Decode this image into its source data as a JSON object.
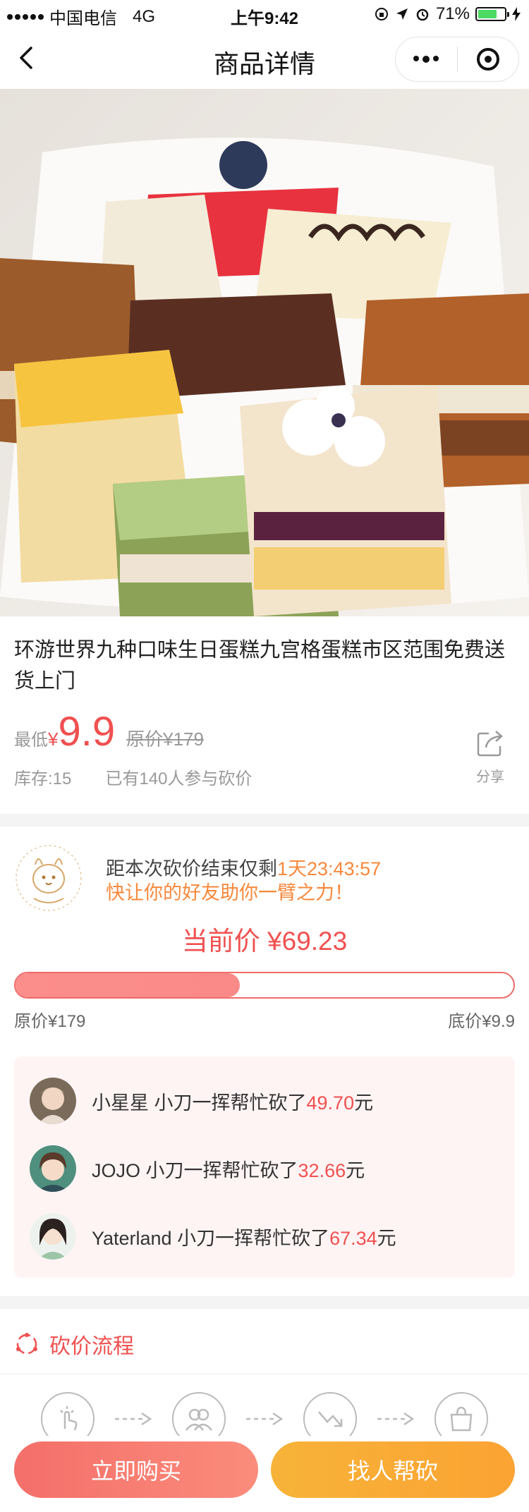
{
  "status_bar": {
    "carrier": "中国电信",
    "network": "4G",
    "time": "上午9:42",
    "battery": "71%",
    "battery_level": 0.71
  },
  "nav": {
    "title": "商品详情",
    "back_icon": "chevron-left-icon",
    "more_icon": "more-dots-icon",
    "close_icon": "target-icon"
  },
  "product": {
    "title": "环游世界九种口味生日蛋糕九宫格蛋糕市区范围免费送货上门",
    "lowest_label": "最低",
    "currency": "¥",
    "price": "9.9",
    "original_price": "原价¥179",
    "stock": "库存:15",
    "participants": "已有140人参与砍价",
    "share_label": "分享",
    "share_icon": "share-icon"
  },
  "bargain": {
    "countdown_prefix": "距本次砍价结束仅剩",
    "countdown": "1天23:43:57",
    "urge": "快让你的好友助你一臂之力！",
    "current_price": "当前价 ¥69.23",
    "progress": 0.45,
    "original_label": "原价¥179",
    "floor_label": "底价¥9.9",
    "helpers": [
      {
        "name": "小星星",
        "text": "小刀一挥帮忙砍了",
        "amount": "49.70",
        "unit": "元"
      },
      {
        "name": "JOJO",
        "text": "小刀一挥帮忙砍了",
        "amount": "32.66",
        "unit": "元"
      },
      {
        "name": "Yaterland",
        "text": "小刀一挥帮忙砍了",
        "amount": "67.34",
        "unit": "元"
      }
    ]
  },
  "flow": {
    "title": "砍价流程",
    "steps": [
      "click-icon",
      "friends-icon",
      "price-down-icon",
      "shop-icon"
    ]
  },
  "actions": {
    "buy_now": "立即购买",
    "ask_help": "找人帮砍"
  },
  "colors": {
    "accent_red": "#f05050",
    "accent_orange": "#f7883b",
    "buy_gradient": "#f46f6a",
    "help_gradient": "#f7b339"
  }
}
